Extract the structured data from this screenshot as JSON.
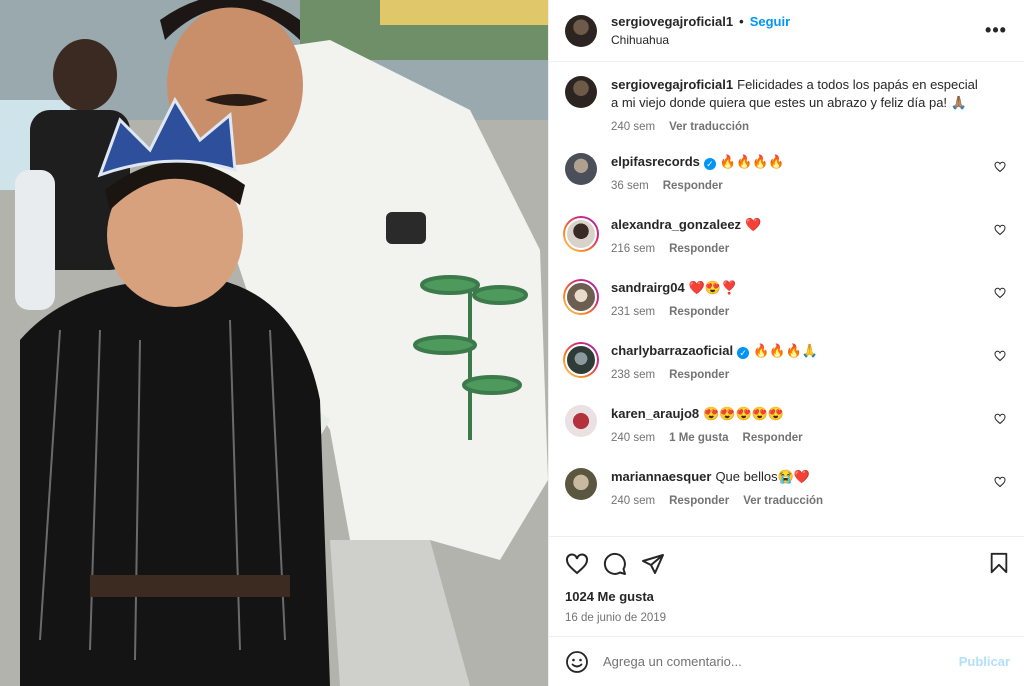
{
  "post": {
    "username": "sergiovegajroficial1",
    "separator": "•",
    "follow_label": "Seguir",
    "location": "Chihuahua",
    "more_label": "•••"
  },
  "caption": {
    "username": "sergiovegajroficial1",
    "text": "Felicidades a todos los papás en especial a mi viejo donde quiera que estes un abrazo y feliz día pa! 🙏🏽",
    "time": "240 sem",
    "translate_label": "Ver traducción"
  },
  "comments": [
    {
      "username": "elpifasrecords",
      "verified": true,
      "text": "🔥🔥🔥🔥",
      "time": "36 sem",
      "likes": "",
      "reply": "Responder",
      "translate": ""
    },
    {
      "username": "alexandra_gonzaleez",
      "verified": false,
      "text": "❤️",
      "time": "216 sem",
      "likes": "",
      "reply": "Responder",
      "translate": ""
    },
    {
      "username": "sandrairg04",
      "verified": false,
      "text": "❤️😍❣️",
      "time": "231 sem",
      "likes": "",
      "reply": "Responder",
      "translate": ""
    },
    {
      "username": "charlybarrazaoficial",
      "verified": true,
      "text": "🔥🔥🔥🙏",
      "time": "238 sem",
      "likes": "",
      "reply": "Responder",
      "translate": ""
    },
    {
      "username": "karen_araujo8",
      "verified": false,
      "text": "😍😍😍😍😍",
      "time": "240 sem",
      "likes": "1 Me gusta",
      "reply": "Responder",
      "translate": ""
    },
    {
      "username": "mariannaesquer",
      "verified": false,
      "text": "Que bellos😭❤️",
      "time": "240 sem",
      "likes": "",
      "reply": "Responder",
      "translate": "Ver traducción"
    }
  ],
  "footer": {
    "likes": "1024 Me gusta",
    "date": "16 de junio de 2019",
    "comment_placeholder": "Agrega un comentario...",
    "publish_label": "Publicar"
  },
  "icons": {
    "verified": "✓",
    "colors": {
      "accent": "#0095f6",
      "muted": "#737373",
      "text": "#262626",
      "publish_disabled": "#b2dffc"
    }
  }
}
